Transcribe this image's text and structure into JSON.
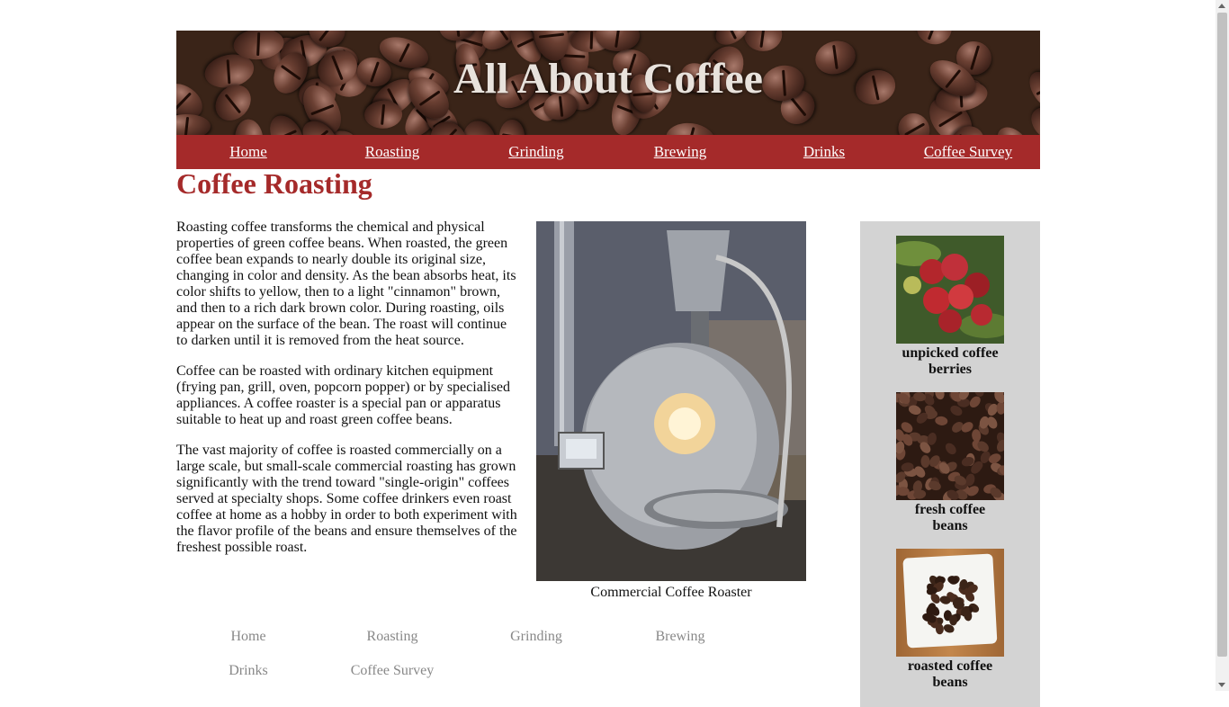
{
  "header": {
    "title": "All About Coffee",
    "nav": [
      "Home",
      "Roasting",
      "Grinding",
      "Brewing",
      "Drinks",
      "Coffee Survey"
    ]
  },
  "page": {
    "title": "Coffee Roasting",
    "paragraphs": [
      "Roasting coffee transforms the chemical and physical properties of green coffee beans. When roasted, the green coffee bean expands to nearly double its original size, changing in color and density. As the bean absorbs heat, its color shifts to yellow, then to a light \"cinnamon\" brown, and then to a rich dark brown color. During roasting, oils appear on the surface of the bean. The roast will continue to darken until it is removed from the heat source.",
      "Coffee can be roasted with ordinary kitchen equipment (frying pan, grill, oven, popcorn popper) or by specialised appliances. A coffee roaster is a special pan or apparatus suitable to heat up and roast green coffee beans.",
      "The vast majority of coffee is roasted commercially on a large scale, but small-scale commercial roasting has grown significantly with the trend toward \"single-origin\" coffees served at specialty shops. Some coffee drinkers even roast coffee at home as a hobby in order to both experiment with the flavor profile of the beans and ensure themselves of the freshest possible roast."
    ],
    "figure_caption": "Commercial Coffee Roaster"
  },
  "sidebar": {
    "items": [
      {
        "label": "unpicked coffee berries"
      },
      {
        "label": "fresh coffee beans"
      },
      {
        "label": "roasted coffee beans"
      }
    ]
  },
  "footer": {
    "nav": [
      "Home",
      "Roasting",
      "Grinding",
      "Brewing",
      "Drinks",
      "Coffee Survey"
    ]
  },
  "colors": {
    "accent": "#a52a2a",
    "sidebar_bg": "#d3d3d3",
    "footer_link": "#888888"
  }
}
